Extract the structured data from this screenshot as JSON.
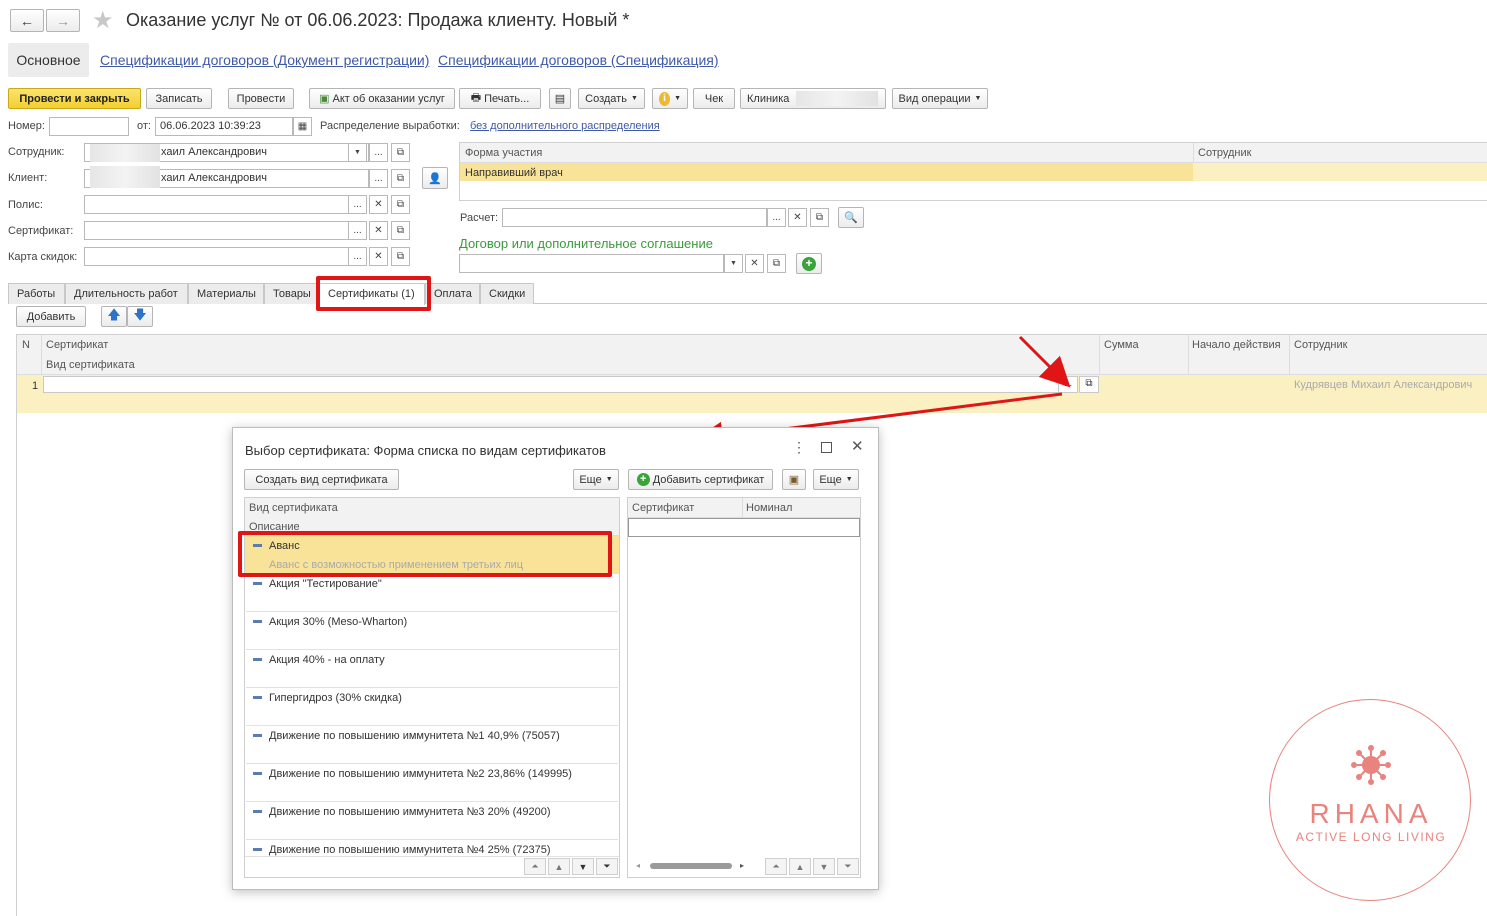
{
  "window": {
    "title": "Оказание услуг №  от 06.06.2023: Продажа клиенту.  Новый *",
    "nav_back": "←",
    "nav_forward": "→"
  },
  "section_tabs": [
    "Основное",
    "Спецификации договоров (Документ регистрации)",
    "Спецификации договоров (Спецификация)"
  ],
  "toolbar": {
    "post_close": "Провести и закрыть",
    "save": "Записать",
    "post": "Провести",
    "act": "Акт об оказании услуг",
    "print": "Печать...",
    "create": "Создать",
    "check": "Чек",
    "clinic": "Клиника",
    "operation": "Вид операции"
  },
  "header": {
    "number_label": "Номер:",
    "number_value": "",
    "date_label": "от:",
    "date_value": "06.06.2023 10:39:23",
    "distribution_label": "Распределение выработки:",
    "distribution_link": "без дополнительного распределения"
  },
  "fields": {
    "employee_label": "Сотрудник:",
    "employee_value": "хаил Александрович",
    "client_label": "Клиент:",
    "client_value": "хаил Александрович",
    "policy_label": "Полис:",
    "certificate_label": "Сертификат:",
    "discount_label": "Карта скидок:",
    "payment_label": "Расчет:",
    "contract_label": "Договор или дополнительное соглашение"
  },
  "participation_table": {
    "col1": "Форма участия",
    "col2": "Сотрудник",
    "row1": "Направивший врач"
  },
  "doc_tabs": [
    "Работы",
    "Длительность работ",
    "Материалы",
    "Товары",
    "Сертификаты (1)",
    "Оплата",
    "Скидки"
  ],
  "cert_toolbar": {
    "add": "Добавить"
  },
  "cert_table": {
    "col_n": "N",
    "col_cert": "Сертификат",
    "col_kind": "Вид сертификата",
    "col_sum": "Сумма",
    "col_start": "Начало действия",
    "col_employee": "Сотрудник",
    "row_n": "1",
    "row_employee": "Кудрявцев Михаил Александрович"
  },
  "dialog": {
    "title": "Выбор сертификата: Форма списка по видам сертификатов",
    "create_kind": "Создать вид сертификата",
    "more": "Еще",
    "add_cert": "Добавить сертификат",
    "more2": "Еще",
    "left_col1": "Вид сертификата",
    "left_col2": "Описание",
    "right_col1": "Сертификат",
    "right_col2": "Номинал",
    "items": [
      {
        "name": "Аванс",
        "desc": "Аванс с возможностью применением третьих лиц"
      },
      {
        "name": "Акция \"Тестирование\"",
        "desc": ""
      },
      {
        "name": "Акция 30% (Meso-Wharton)",
        "desc": ""
      },
      {
        "name": "Акция 40% - на оплату",
        "desc": ""
      },
      {
        "name": "Гипергидроз (30% скидка)",
        "desc": ""
      },
      {
        "name": "Движение по повышению иммунитета №1 40,9% (75057)",
        "desc": ""
      },
      {
        "name": "Движение по повышению иммунитета №2 23,86% (149995)",
        "desc": ""
      },
      {
        "name": "Движение по повышению иммунитета №3 20% (49200)",
        "desc": ""
      },
      {
        "name": "Движение по повышению иммунитета №4 25% (72375)",
        "desc": ""
      }
    ]
  },
  "logo": {
    "brand": "RHANA",
    "tagline": "ACTIVE LONG LIVING"
  },
  "colors": {
    "accent_yellow": "#f3cf30",
    "highlight_red": "#e01515",
    "row_yellow": "#fbf0c2",
    "link_blue": "#3f59a8",
    "green_heading": "#3a9a3a",
    "logo_pink": "#e8837e"
  }
}
